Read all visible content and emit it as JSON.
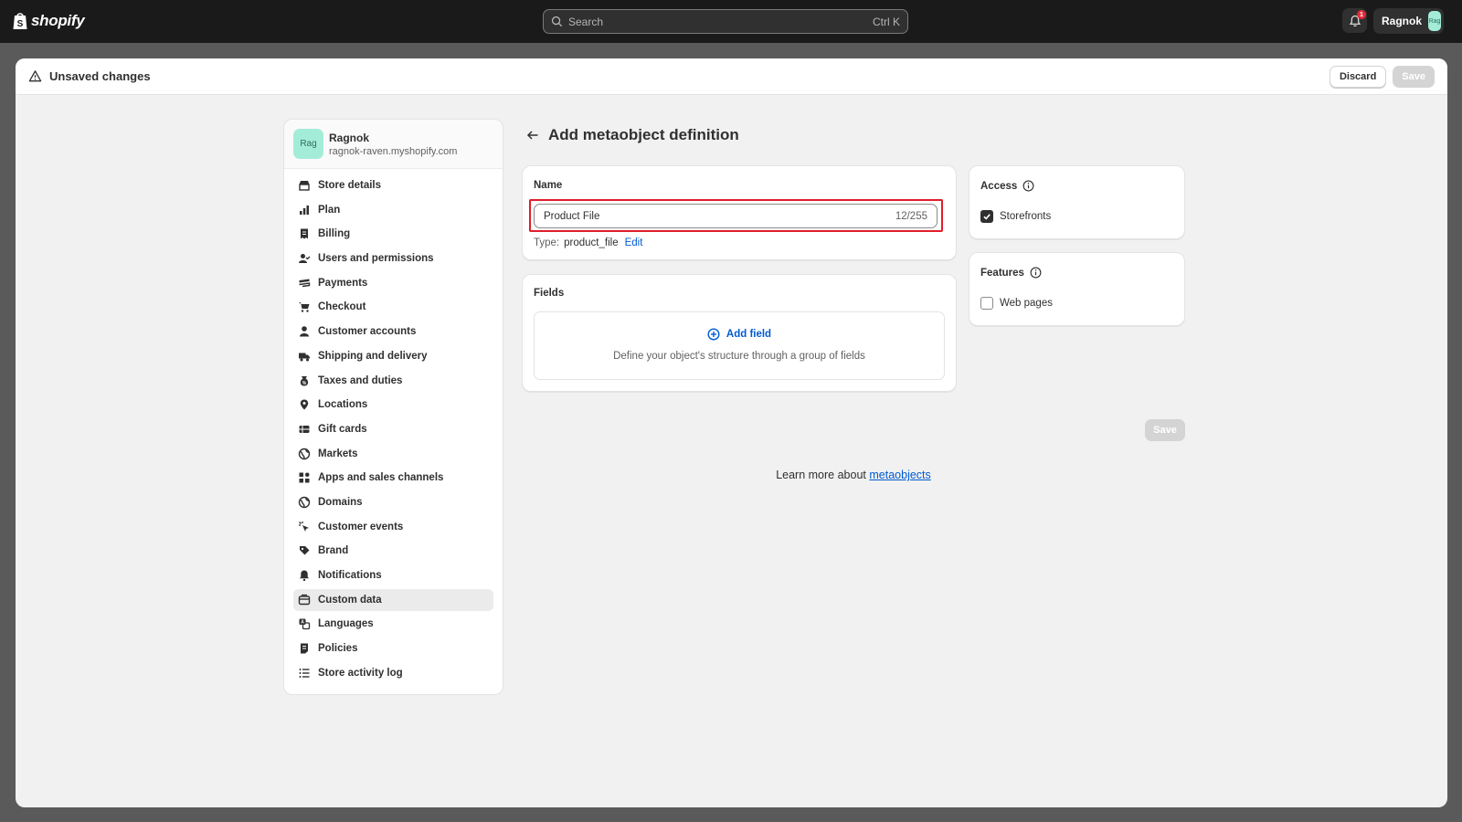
{
  "topbar": {
    "logo_text": "shopify",
    "search_placeholder": "Search",
    "search_shortcut": "Ctrl K",
    "notification_count": "1",
    "user_name": "Ragnok",
    "user_avatar": "Rag"
  },
  "savebar": {
    "title": "Unsaved changes",
    "discard_label": "Discard",
    "save_label": "Save"
  },
  "store": {
    "avatar": "Rag",
    "name": "Ragnok",
    "domain": "ragnok-raven.myshopify.com"
  },
  "sidebar": {
    "items": [
      {
        "label": "Store details",
        "icon": "store-icon"
      },
      {
        "label": "Plan",
        "icon": "plan-icon"
      },
      {
        "label": "Billing",
        "icon": "billing-icon"
      },
      {
        "label": "Users and permissions",
        "icon": "users-icon"
      },
      {
        "label": "Payments",
        "icon": "payments-icon"
      },
      {
        "label": "Checkout",
        "icon": "cart-icon"
      },
      {
        "label": "Customer accounts",
        "icon": "person-icon"
      },
      {
        "label": "Shipping and delivery",
        "icon": "truck-icon"
      },
      {
        "label": "Taxes and duties",
        "icon": "tax-icon"
      },
      {
        "label": "Locations",
        "icon": "location-icon"
      },
      {
        "label": "Gift cards",
        "icon": "gift-card-icon"
      },
      {
        "label": "Markets",
        "icon": "globe-icon"
      },
      {
        "label": "Apps and sales channels",
        "icon": "apps-icon"
      },
      {
        "label": "Domains",
        "icon": "globe-icon"
      },
      {
        "label": "Customer events",
        "icon": "cursor-icon"
      },
      {
        "label": "Brand",
        "icon": "brand-icon"
      },
      {
        "label": "Notifications",
        "icon": "bell-icon"
      },
      {
        "label": "Custom data",
        "icon": "custom-data-icon",
        "active": true
      },
      {
        "label": "Languages",
        "icon": "language-icon"
      },
      {
        "label": "Policies",
        "icon": "policy-icon"
      },
      {
        "label": "Store activity log",
        "icon": "list-icon"
      }
    ]
  },
  "page": {
    "title": "Add metaobject definition"
  },
  "name_card": {
    "label": "Name",
    "value": "Product File",
    "counter": "12/255",
    "type_label": "Type:",
    "type_value": "product_file",
    "edit_label": "Edit"
  },
  "fields_card": {
    "label": "Fields",
    "add_label": "Add field",
    "help_text": "Define your object's structure through a group of fields"
  },
  "access_card": {
    "title": "Access",
    "option_label": "Storefronts",
    "checked": true
  },
  "features_card": {
    "title": "Features",
    "option_label": "Web pages",
    "checked": false
  },
  "footer": {
    "save_label": "Save",
    "learn_prefix": "Learn more about",
    "learn_link": "metaobjects"
  },
  "colors": {
    "highlight": "#e11d2b",
    "link": "#005bd3",
    "topbar": "#1a1a1a"
  }
}
